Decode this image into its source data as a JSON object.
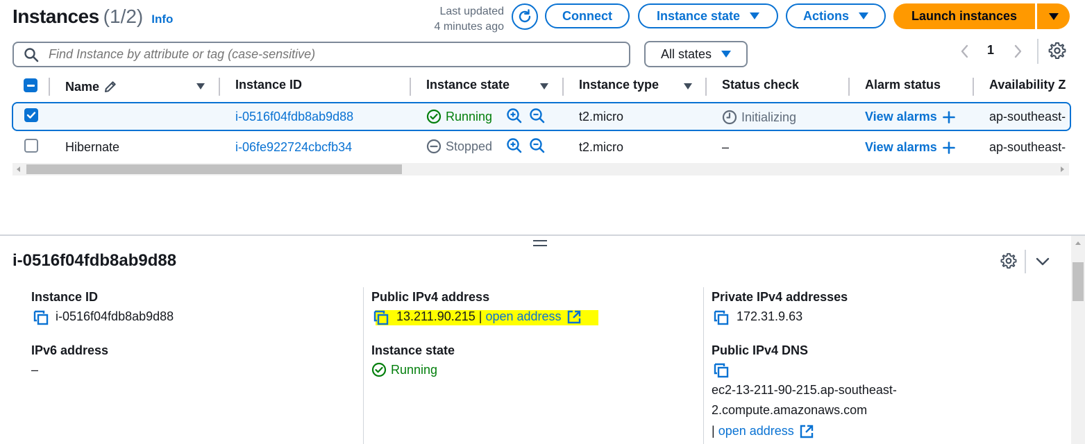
{
  "header": {
    "title": "Instances",
    "count": "(1/2)",
    "info_label": "Info",
    "last_updated_line1": "Last updated",
    "last_updated_line2": "4 minutes ago",
    "connect_label": "Connect",
    "instance_state_label": "Instance state",
    "actions_label": "Actions",
    "launch_label": "Launch instances"
  },
  "filter": {
    "search_placeholder": "Find Instance by attribute or tag (case-sensitive)",
    "states_label": "All states",
    "page_number": "1"
  },
  "table": {
    "columns": {
      "name": "Name",
      "instance_id": "Instance ID",
      "instance_state": "Instance state",
      "instance_type": "Instance type",
      "status_check": "Status check",
      "alarm_status": "Alarm status",
      "availability_zone": "Availability Z"
    },
    "rows": [
      {
        "selected": true,
        "name": "",
        "instance_id": "i-0516f04fdb8ab9d88",
        "state": "Running",
        "type": "t2.micro",
        "status_check": "Initializing",
        "alarm": "View alarms",
        "az": "ap-southeast-"
      },
      {
        "selected": false,
        "name": "Hibernate",
        "instance_id": "i-06fe922724cbcfb34",
        "state": "Stopped",
        "type": "t2.micro",
        "status_check": "–",
        "alarm": "View alarms",
        "az": "ap-southeast-"
      }
    ]
  },
  "details": {
    "title": "i-0516f04fdb8ab9d88",
    "instance_id_label": "Instance ID",
    "instance_id_value": "i-0516f04fdb8ab9d88",
    "ipv6_label": "IPv6 address",
    "ipv6_value": "–",
    "public_ipv4_label": "Public IPv4 address",
    "public_ipv4_value": "13.211.90.215",
    "public_ipv4_sep": "|",
    "public_ipv4_link": "open address",
    "instance_state_label": "Instance state",
    "instance_state_value": "Running",
    "private_ipv4_label": "Private IPv4 addresses",
    "private_ipv4_value": "172.31.9.63",
    "public_dns_label": "Public IPv4 DNS",
    "public_dns_line1": "ec2-13-211-90-215.ap-southeast-",
    "public_dns_line2": "2.compute.amazonaws.com",
    "public_dns_sep": "|",
    "public_dns_link": "open address"
  },
  "colors": {
    "primary": "#0972d3",
    "launch": "#ff9900",
    "running": "#037f0c",
    "highlight": "#ffff00"
  }
}
